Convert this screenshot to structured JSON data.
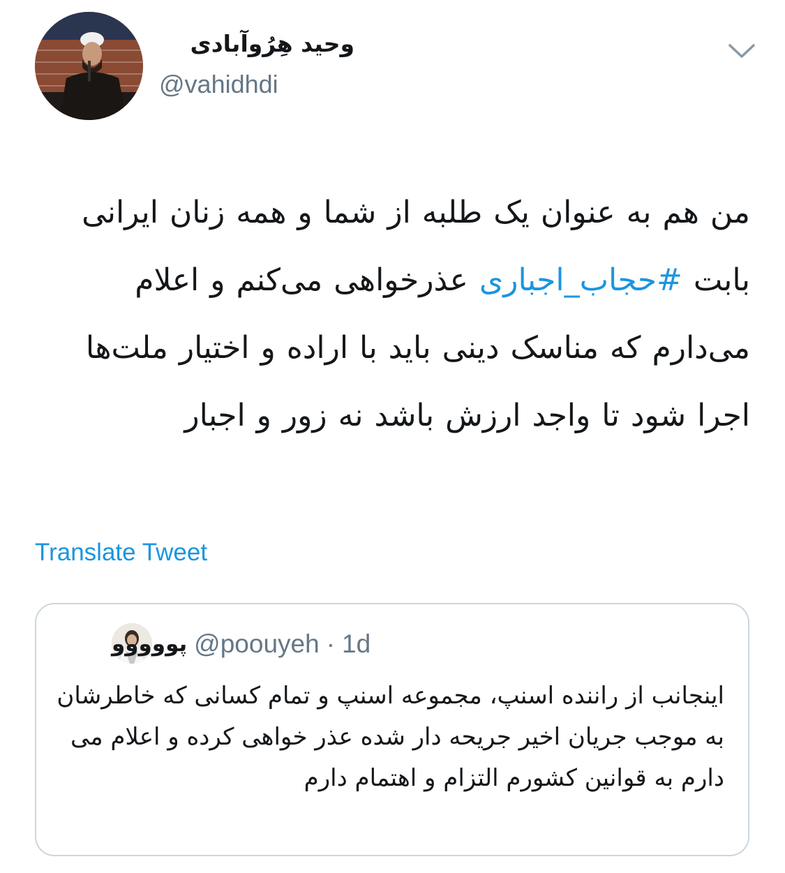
{
  "author": {
    "display_name": "وحید هِرُوآبادی",
    "handle": "@vahidhdi"
  },
  "tweet": {
    "text_before": "من هم به عنوان یک طلبه از شما و همه زنان ایرانی بابت ",
    "hashtag": "#حجاب_اجباری",
    "text_after": " عذرخواهی می‌کنم و اعلام می‌دارم که مناسک دینی باید با اراده و اختیار ملت‌ها اجرا شود تا واجد ارزش باشد نه زور و اجبار"
  },
  "translate_label": "Translate Tweet",
  "quoted_tweet": {
    "display_name": "پووووو",
    "handle": "@poouyeh",
    "separator": "·",
    "time": "1d",
    "text": "اینجانب از راننده اسنپ، مجموعه اسنپ و تمام کسانی که خاطرشان به موجب جریان اخیر جریحه دار شده عذر خواهی کرده و اعلام می دارم به قوانین کشورم التزام و اهتمام دارم"
  },
  "icons": {
    "menu": "chevron-down-icon"
  },
  "colors": {
    "link": "#1b95e0",
    "secondary_text": "#657786",
    "border": "#ccd6dd"
  }
}
